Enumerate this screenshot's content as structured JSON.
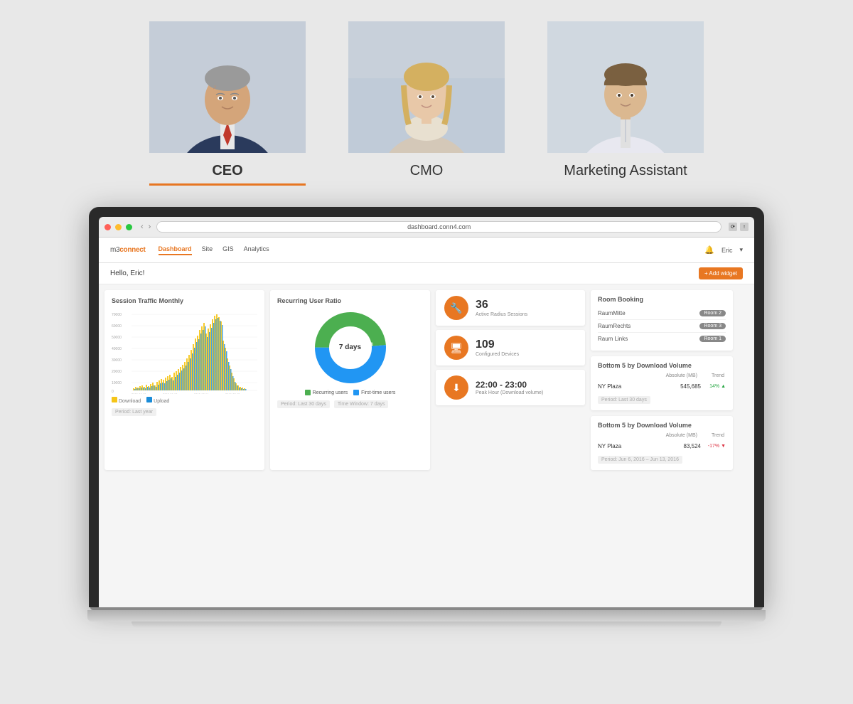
{
  "page": {
    "background": "#e8e8e8"
  },
  "people": [
    {
      "id": "ceo",
      "name": "CEO",
      "active": true,
      "photo_color": "#9faab8"
    },
    {
      "id": "cmo",
      "name": "CMO",
      "active": false,
      "photo_color": "#b8c2cc"
    },
    {
      "id": "marketing-assistant",
      "name": "Marketing Assistant",
      "active": false,
      "photo_color": "#c0c8d0"
    }
  ],
  "browser": {
    "url": "dashboard.conn4.com",
    "reload_label": "⟳"
  },
  "nav": {
    "logo": "m3connect",
    "links": [
      "Dashboard",
      "Site",
      "GIS",
      "Analytics"
    ],
    "active_link": "Dashboard",
    "user": "Eric",
    "bell": "🔔"
  },
  "greeting": {
    "text": "Hello, Eric!",
    "add_widget_label": "+ Add widget"
  },
  "session_traffic": {
    "title": "Session Traffic Monthly",
    "period_label": "Period: Last year",
    "legend_download": "Download",
    "legend_upload": "Upload",
    "y_labels": [
      "70000",
      "60000",
      "50000",
      "40000",
      "30000",
      "20000",
      "10000",
      "0"
    ],
    "x_labels": [
      "2015-06-13",
      "2015-09-13",
      "2015-12-14",
      "2016-03-15"
    ]
  },
  "recurring_user": {
    "title": "Recurring User Ratio",
    "center_text": "7 days",
    "pct_returning": "48.7%",
    "pct_new": "51.3%",
    "color_returning": "#4CAF50",
    "color_new": "#2196F3",
    "legend_recurring": "Recurring users",
    "legend_first": "First-time users",
    "period_label": "Period: Last 30 days",
    "time_window_label": "Time Window: 7 days"
  },
  "stats": [
    {
      "id": "radius",
      "number": "36",
      "label": "Active Radius Sessions",
      "icon": "🔧",
      "icon_color": "#e87722"
    },
    {
      "id": "devices",
      "number": "109",
      "label": "Configured Devices",
      "icon": "🖥",
      "icon_color": "#e87722"
    },
    {
      "id": "peak-hour",
      "number": "22:00 - 23:00",
      "label": "Peak Hour (Download volume)",
      "icon": "⬇",
      "icon_color": "#e87722"
    }
  ],
  "room_booking": {
    "title": "Room Booking",
    "rooms": [
      {
        "name": "RaumMitte",
        "badge": "Room 2"
      },
      {
        "name": "RaumRechts",
        "badge": "Room 3"
      },
      {
        "name": "Raum Links",
        "badge": "Room 1"
      }
    ]
  },
  "bottom5_top": {
    "title": "Bottom 5 by Download Volume",
    "col_absolute": "Absolute (MB)",
    "col_trend": "Trend",
    "rows": [
      {
        "name": "NY Plaza",
        "value": "545,685",
        "trend": "14%",
        "trend_dir": "up"
      }
    ],
    "period_label": "Period: Last 30 days"
  },
  "bottom5_bottom": {
    "title": "Bottom 5 by Download Volume",
    "col_absolute": "Absolute (MB)",
    "col_trend": "Trend",
    "rows": [
      {
        "name": "NY Plaza",
        "value": "83,524",
        "trend": "-17%",
        "trend_dir": "down"
      }
    ],
    "period_label": "Period: Jun 6, 2016 – Jun 13, 2016"
  }
}
